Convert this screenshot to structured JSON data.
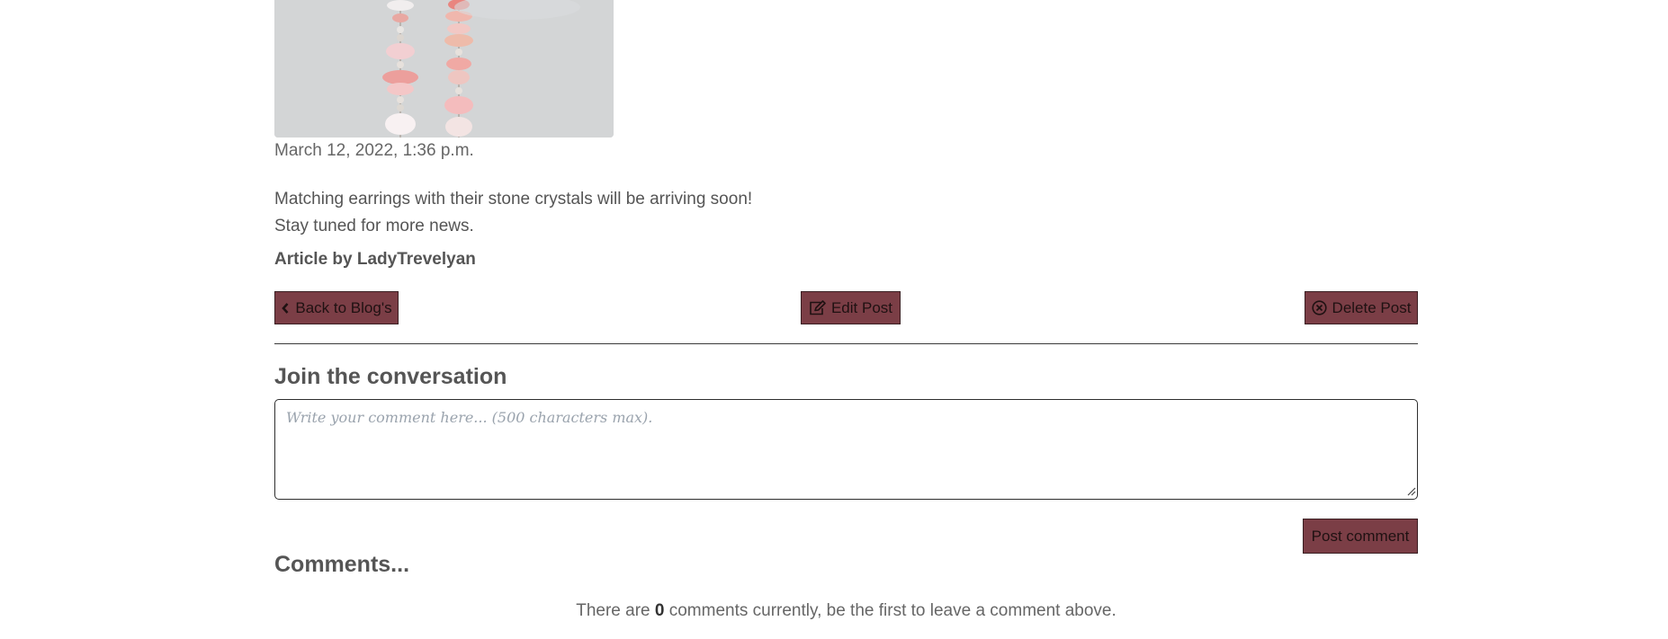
{
  "post": {
    "date": "March 12, 2022, 1:36 p.m.",
    "body_line_1": "Matching earrings with their stone crystals will be arriving soon!",
    "body_line_2": "Stay tuned for more news.",
    "author_label": "Article by",
    "author_name": "LadyTrevelyan"
  },
  "actions": {
    "back_label": "Back to Blog's",
    "back_icon": "chevron-left-icon",
    "edit_label": "Edit Post",
    "edit_icon": "edit-icon",
    "delete_label": "Delete Post",
    "delete_icon": "close-circle-icon"
  },
  "conversation": {
    "heading": "Join the conversation",
    "placeholder": "Write your comment here... (500 characters max).",
    "value": "",
    "post_button_label": "Post comment"
  },
  "comments": {
    "heading": "Comments...",
    "empty_prefix": "There are",
    "count": "0",
    "empty_suffix": "comments currently, be the first to leave a comment above."
  },
  "colors": {
    "button_bg": "#7b3e46",
    "button_border": "#3a1e22",
    "text": "#555555"
  }
}
